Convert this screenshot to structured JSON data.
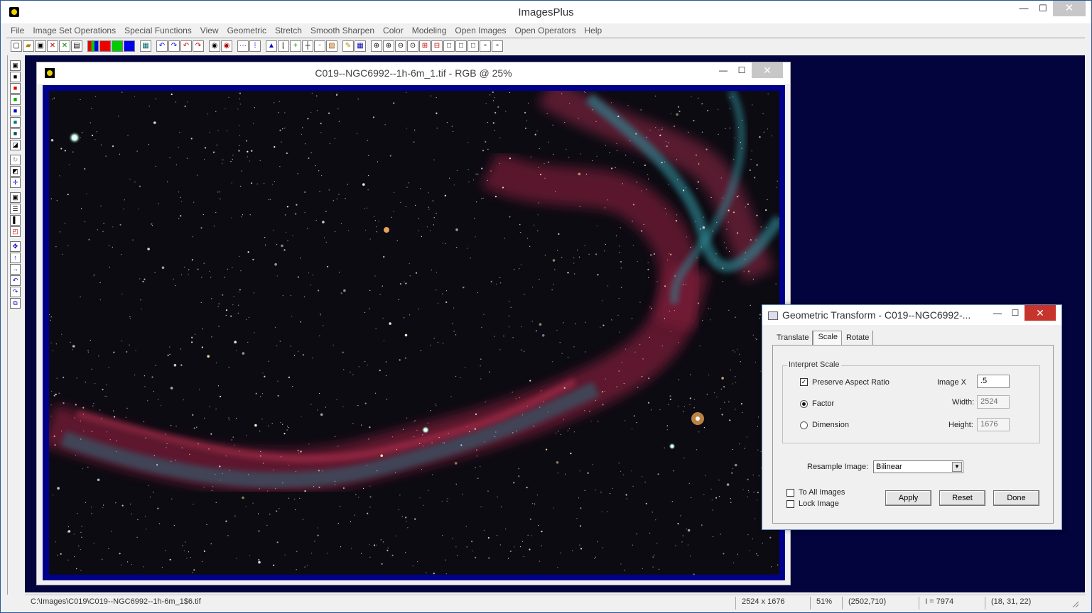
{
  "app": {
    "title": "ImagesPlus",
    "minimize": "—",
    "maximize": "☐",
    "close": "✕"
  },
  "menu": [
    "File",
    "Image Set Operations",
    "Special Functions",
    "View",
    "Geometric",
    "Stretch",
    "Smooth Sharpen",
    "Color",
    "Modeling",
    "Open Images",
    "Open Operators",
    "Help"
  ],
  "toolbar_icons": [
    "new-icon",
    "open-icon",
    "save-icon",
    "close-icon",
    "close-all-icon",
    "copy-icon",
    "rgb-icon",
    "red-channel-icon",
    "green-channel-icon",
    "blue-channel-icon",
    "histogram-icon",
    "undo-icon",
    "redo-icon",
    "undo-all-icon",
    "redo-all-icon",
    "mask-icon",
    "mask-invert-icon",
    "line-icon",
    "dots-icon",
    "triangle-icon",
    "levels-icon",
    "plus-icon",
    "crosshair-icon",
    "grid-icon",
    "image-icon",
    "pencil-icon",
    "table-icon",
    "zoom-fit-icon",
    "zoom-in-icon",
    "zoom-out-icon",
    "zoom-icon",
    "add-frame-icon",
    "remove-frame-icon",
    "frame-1-icon",
    "frame-2-icon",
    "frame-3-icon",
    "frame-4-icon",
    "frame-5-icon"
  ],
  "image_window": {
    "title": "C019--NGC6992--1h-6m_1.tif - RGB @ 25%",
    "minimize": "—",
    "maximize": "☐",
    "close": "✕"
  },
  "dialog": {
    "title": "Geometric Transform - C019--NGC6992-...",
    "minimize": "—",
    "maximize": "☐",
    "close": "✕",
    "tabs": [
      "Translate",
      "Scale",
      "Rotate"
    ],
    "active_tab": "Scale",
    "group_label": "Interpret Scale",
    "preserve_aspect_ratio": {
      "label": "Preserve Aspect Ratio",
      "checked": true
    },
    "factor": {
      "label": "Factor",
      "selected": true
    },
    "dimension": {
      "label": "Dimension",
      "selected": false
    },
    "image_x": {
      "label": "Image X",
      "value": ".5"
    },
    "width": {
      "label": "Width:",
      "value": "2524"
    },
    "height": {
      "label": "Height:",
      "value": "1676"
    },
    "resample": {
      "label": "Resample Image:",
      "value": "Bilinear"
    },
    "to_all_images": {
      "label": "To All Images",
      "checked": false
    },
    "lock_image": {
      "label": "Lock Image",
      "checked": false
    },
    "apply": "Apply",
    "reset": "Reset",
    "done": "Done"
  },
  "status": {
    "path": "C:\\Images\\C019\\C019--NGC6992--1h-6m_1$6.tif",
    "dimensions": "2524 x 1676",
    "zoom": "51%",
    "coords": "(2502,710)",
    "intensity": "I = 7974",
    "rgb": "(18, 31, 22)"
  }
}
